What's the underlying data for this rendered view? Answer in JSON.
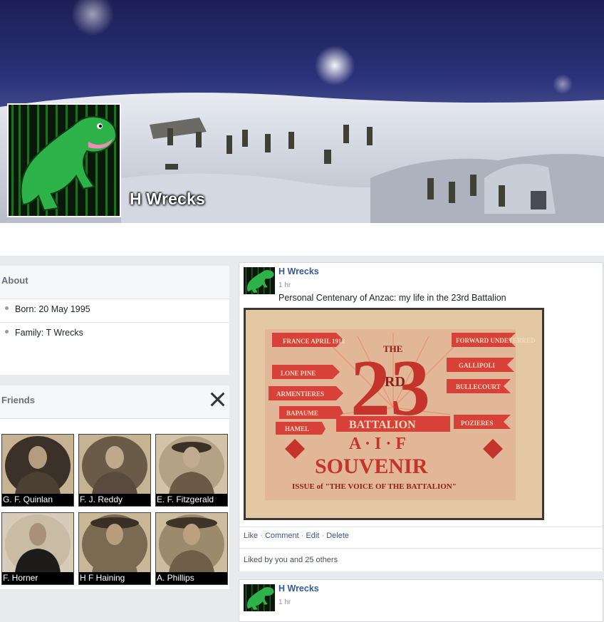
{
  "profile": {
    "name": "H Wrecks"
  },
  "about": {
    "title": "About",
    "items": [
      {
        "label": "Born: 20 May 1995"
      },
      {
        "label": "Family: T Wrecks"
      }
    ]
  },
  "friends": {
    "title": "Friends",
    "list": [
      {
        "name": "G. F. Quinlan"
      },
      {
        "name": "F. J. Reddy"
      },
      {
        "name": "E. F. Fitzgerald"
      },
      {
        "name": "F. Horner"
      },
      {
        "name": "H F Haining"
      },
      {
        "name": "A. Phillips"
      }
    ]
  },
  "posts": [
    {
      "author": "H Wrecks",
      "time": "1 hr",
      "text": "Personal Centenary of Anzac: my life in the 23rd Battalion",
      "image": {
        "the": "THE",
        "number": "23",
        "suffix": "RD",
        "battalion": "BATTALION",
        "aif": "A · I · F",
        "souvenir": "SOUVENIR",
        "issue": "ISSUE of \"THE VOICE OF THE BATTALION\"",
        "ribbons_left": [
          "FRANCE APRIL 1918",
          "LONE PINE",
          "ARMENTIERES",
          "BAPAUME",
          "HAMEL"
        ],
        "ribbons_right": [
          "FORWARD UNDETERRED",
          "GALLIPOLI",
          "BULLECOURT",
          "POZIERES"
        ]
      },
      "actions": {
        "like": "Like",
        "comment": "Comment",
        "edit": "Edit",
        "delete": "Delete",
        "sep": "·"
      },
      "likes": "Liked by you and 25 others"
    },
    {
      "author": "H Wrecks",
      "time": "1 hr"
    }
  ],
  "colors": {
    "link": "#365899",
    "dino_green": "#2db34a",
    "souvenir_red": "#d8413a",
    "souvenir_paper": "#e8c9a2"
  },
  "icons": [
    "dinosaur-avatar-icon",
    "close-icon",
    "bullet-icon"
  ]
}
